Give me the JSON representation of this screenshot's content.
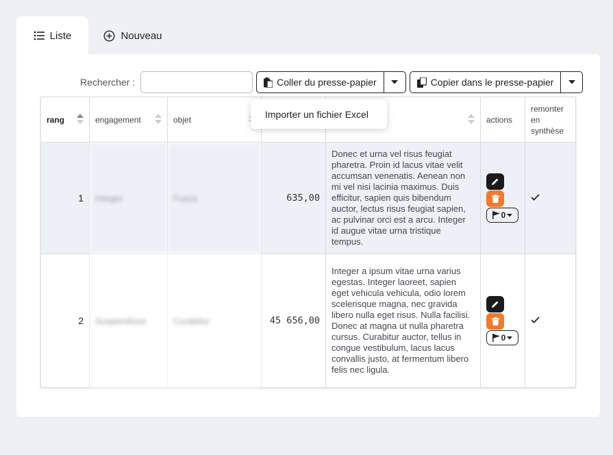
{
  "tabs": [
    {
      "label": "Liste",
      "icon": "list-icon"
    },
    {
      "label": "Nouveau",
      "icon": "plus-circle-icon"
    }
  ],
  "toolbar": {
    "search_label": "Rechercher :",
    "search_value": "",
    "paste_label": "Coller du presse-papier",
    "copy_label": "Copier dans le presse-papier"
  },
  "dropdown": {
    "item": "Importer un fichier Excel"
  },
  "table": {
    "headers": [
      "rang",
      "engagement",
      "objet",
      "",
      "",
      "actions",
      "remonter en synthèse"
    ],
    "rows": [
      {
        "rang": "1",
        "engagement": "Integer",
        "objet": "Fusce",
        "montant": "635,00",
        "description": "Donec et urna vel risus feugiat pharetra. Proin id lacus vitae velit accumsan venenatis. Aenean non mi vel nisi lacinia maximus. Duis efficitur, sapien quis bibendum auctor, lectus risus feugiat sapien, ac pulvinar orci est a arcu. Integer id augue vitae urna tristique tempus.",
        "flag_count": "0",
        "synthese": true
      },
      {
        "rang": "2",
        "engagement": "Suspendisse",
        "objet": "Curabitur",
        "montant": "45 656,00",
        "description": "Integer a ipsum vitae urna varius egestas. Integer laoreet, sapien eget vehicula vehicula, odio lorem scelerisque magna, nec gravida libero nulla eget risus. Nulla facilisi. Donec at magna ut nulla pharetra cursus. Curabitur auctor, tellus in congue vestibulum, lacus lacus convallis justo, at fermentum libero felis nec ligula.",
        "flag_count": "0",
        "synthese": true
      }
    ]
  },
  "colors": {
    "edit": "#1b1b1b",
    "delete": "#f07a30",
    "row_alt": "#eef0f7",
    "background": "#eef0f6"
  }
}
